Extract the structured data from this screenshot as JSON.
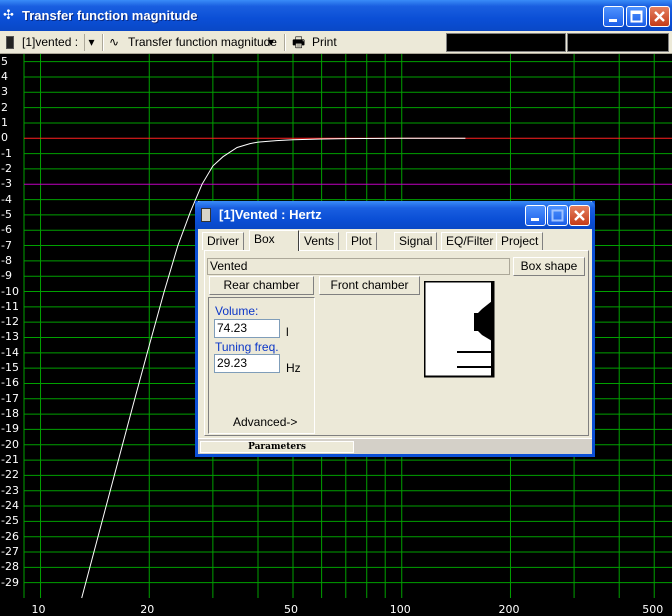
{
  "window": {
    "title": "Transfer function magnitude",
    "icon": "crosshair-icon"
  },
  "toolbar": {
    "project_select": "[1]vented :",
    "graph_select": "Transfer function magnitude",
    "print_label": "Print"
  },
  "plot": {
    "y_ticks": [
      "5",
      "4",
      "3",
      "2",
      "1",
      "0",
      "-1",
      "-2",
      "-3",
      "-4",
      "-5",
      "-6",
      "-7",
      "-8",
      "-9",
      "-10",
      "-11",
      "-12",
      "-13",
      "-14",
      "-15",
      "-16",
      "-17",
      "-18",
      "-19",
      "-20",
      "-21",
      "-22",
      "-23",
      "-24",
      "-25",
      "-26",
      "-27",
      "-28",
      "-29"
    ],
    "x_ticks": [
      "10",
      "20",
      "50",
      "100",
      "200",
      "500"
    ],
    "grid_color": "#00a000",
    "zero_line_color": "#ff2020",
    "minus3_line_color": "#c000c0",
    "curve_color": "#ffffff"
  },
  "chart_data": {
    "type": "line",
    "x_scale": "log",
    "xlim": [
      9,
      560
    ],
    "ylim": [
      -30,
      5.5
    ],
    "series": [
      {
        "x": [
          13,
          15,
          18,
          20,
          22,
          24,
          26,
          28,
          30,
          32,
          35,
          38,
          40,
          45,
          50,
          60,
          70,
          100,
          150
        ],
        "y": [
          -30,
          -24.5,
          -17.5,
          -13.5,
          -10,
          -7,
          -4.8,
          -3,
          -1.8,
          -1.2,
          -0.6,
          -0.35,
          -0.25,
          -0.15,
          -0.1,
          -0.05,
          -0.02,
          0,
          0
        ]
      }
    ]
  },
  "dialog": {
    "title": "[1]Vented : Hertz",
    "tabs": [
      "Driver",
      "Box",
      "Vents",
      "Plot",
      "Signal",
      "EQ/Filter",
      "Project"
    ],
    "active_tab": "Box",
    "box_type": "Vented",
    "box_shape_button": "Box shape",
    "rear_chamber_button": "Rear chamber",
    "front_chamber_button": "Front chamber",
    "volume_label": "Volume:",
    "volume_value": "74.23",
    "volume_unit": "l",
    "tuning_label": "Tuning freq.",
    "tuning_value": "29.23",
    "tuning_unit": "Hz",
    "advanced_label": "Advanced->",
    "status_label": "Parameters"
  }
}
